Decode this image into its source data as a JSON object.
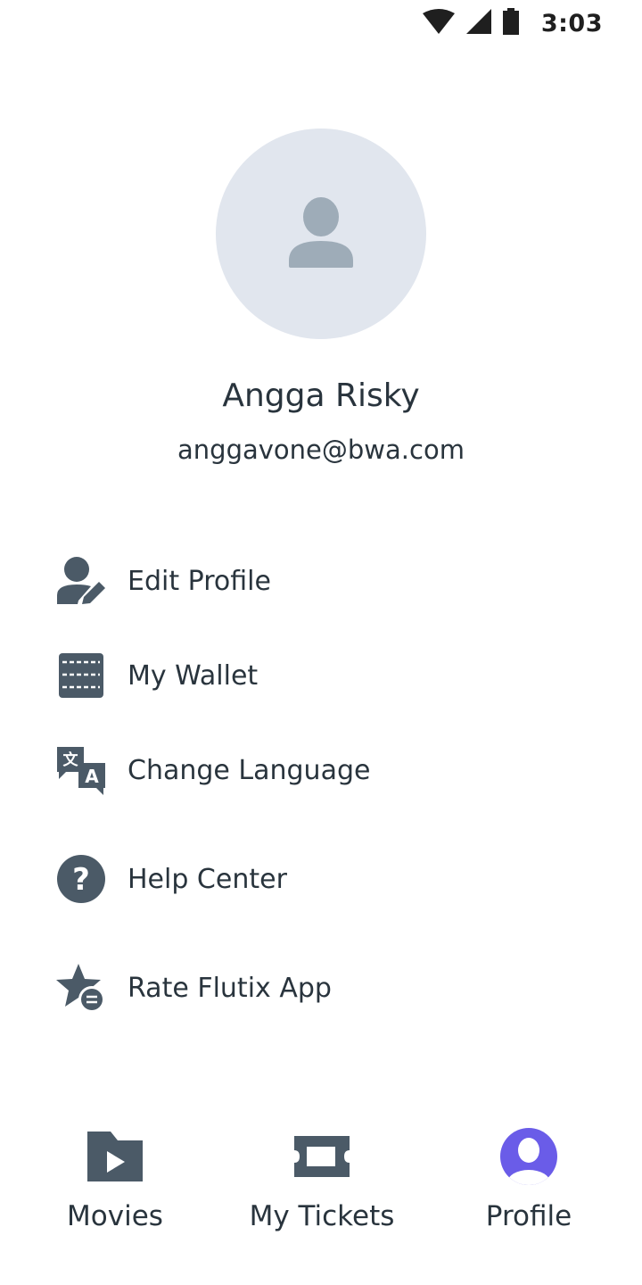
{
  "status_bar": {
    "time": "3:03",
    "icons": [
      "wifi-icon",
      "cellular-signal-icon",
      "battery-icon"
    ]
  },
  "profile": {
    "name": "Angga Risky",
    "email": "anggavone@bwa.com",
    "avatar_icon": "person-placeholder-icon"
  },
  "menu": {
    "items": [
      {
        "label": "Edit Profile",
        "icon": "edit-profile-icon"
      },
      {
        "label": "My Wallet",
        "icon": "wallet-icon"
      },
      {
        "label": "Change Language",
        "icon": "translate-icon"
      },
      {
        "label": "Help Center",
        "icon": "help-icon"
      },
      {
        "label": "Rate Flutix App",
        "icon": "rate-star-icon"
      }
    ]
  },
  "bottom_nav": {
    "items": [
      {
        "label": "Movies",
        "icon": "movie-folder-icon",
        "active": false
      },
      {
        "label": "My Tickets",
        "icon": "ticket-icon",
        "active": false
      },
      {
        "label": "Profile",
        "icon": "profile-icon",
        "active": true
      }
    ]
  },
  "colors": {
    "text": "#29343d",
    "icon": "#4b5a67",
    "avatar_bg": "#e1e6ee",
    "avatar_icon": "#9eacb8",
    "accent": "#6a5ce8"
  }
}
